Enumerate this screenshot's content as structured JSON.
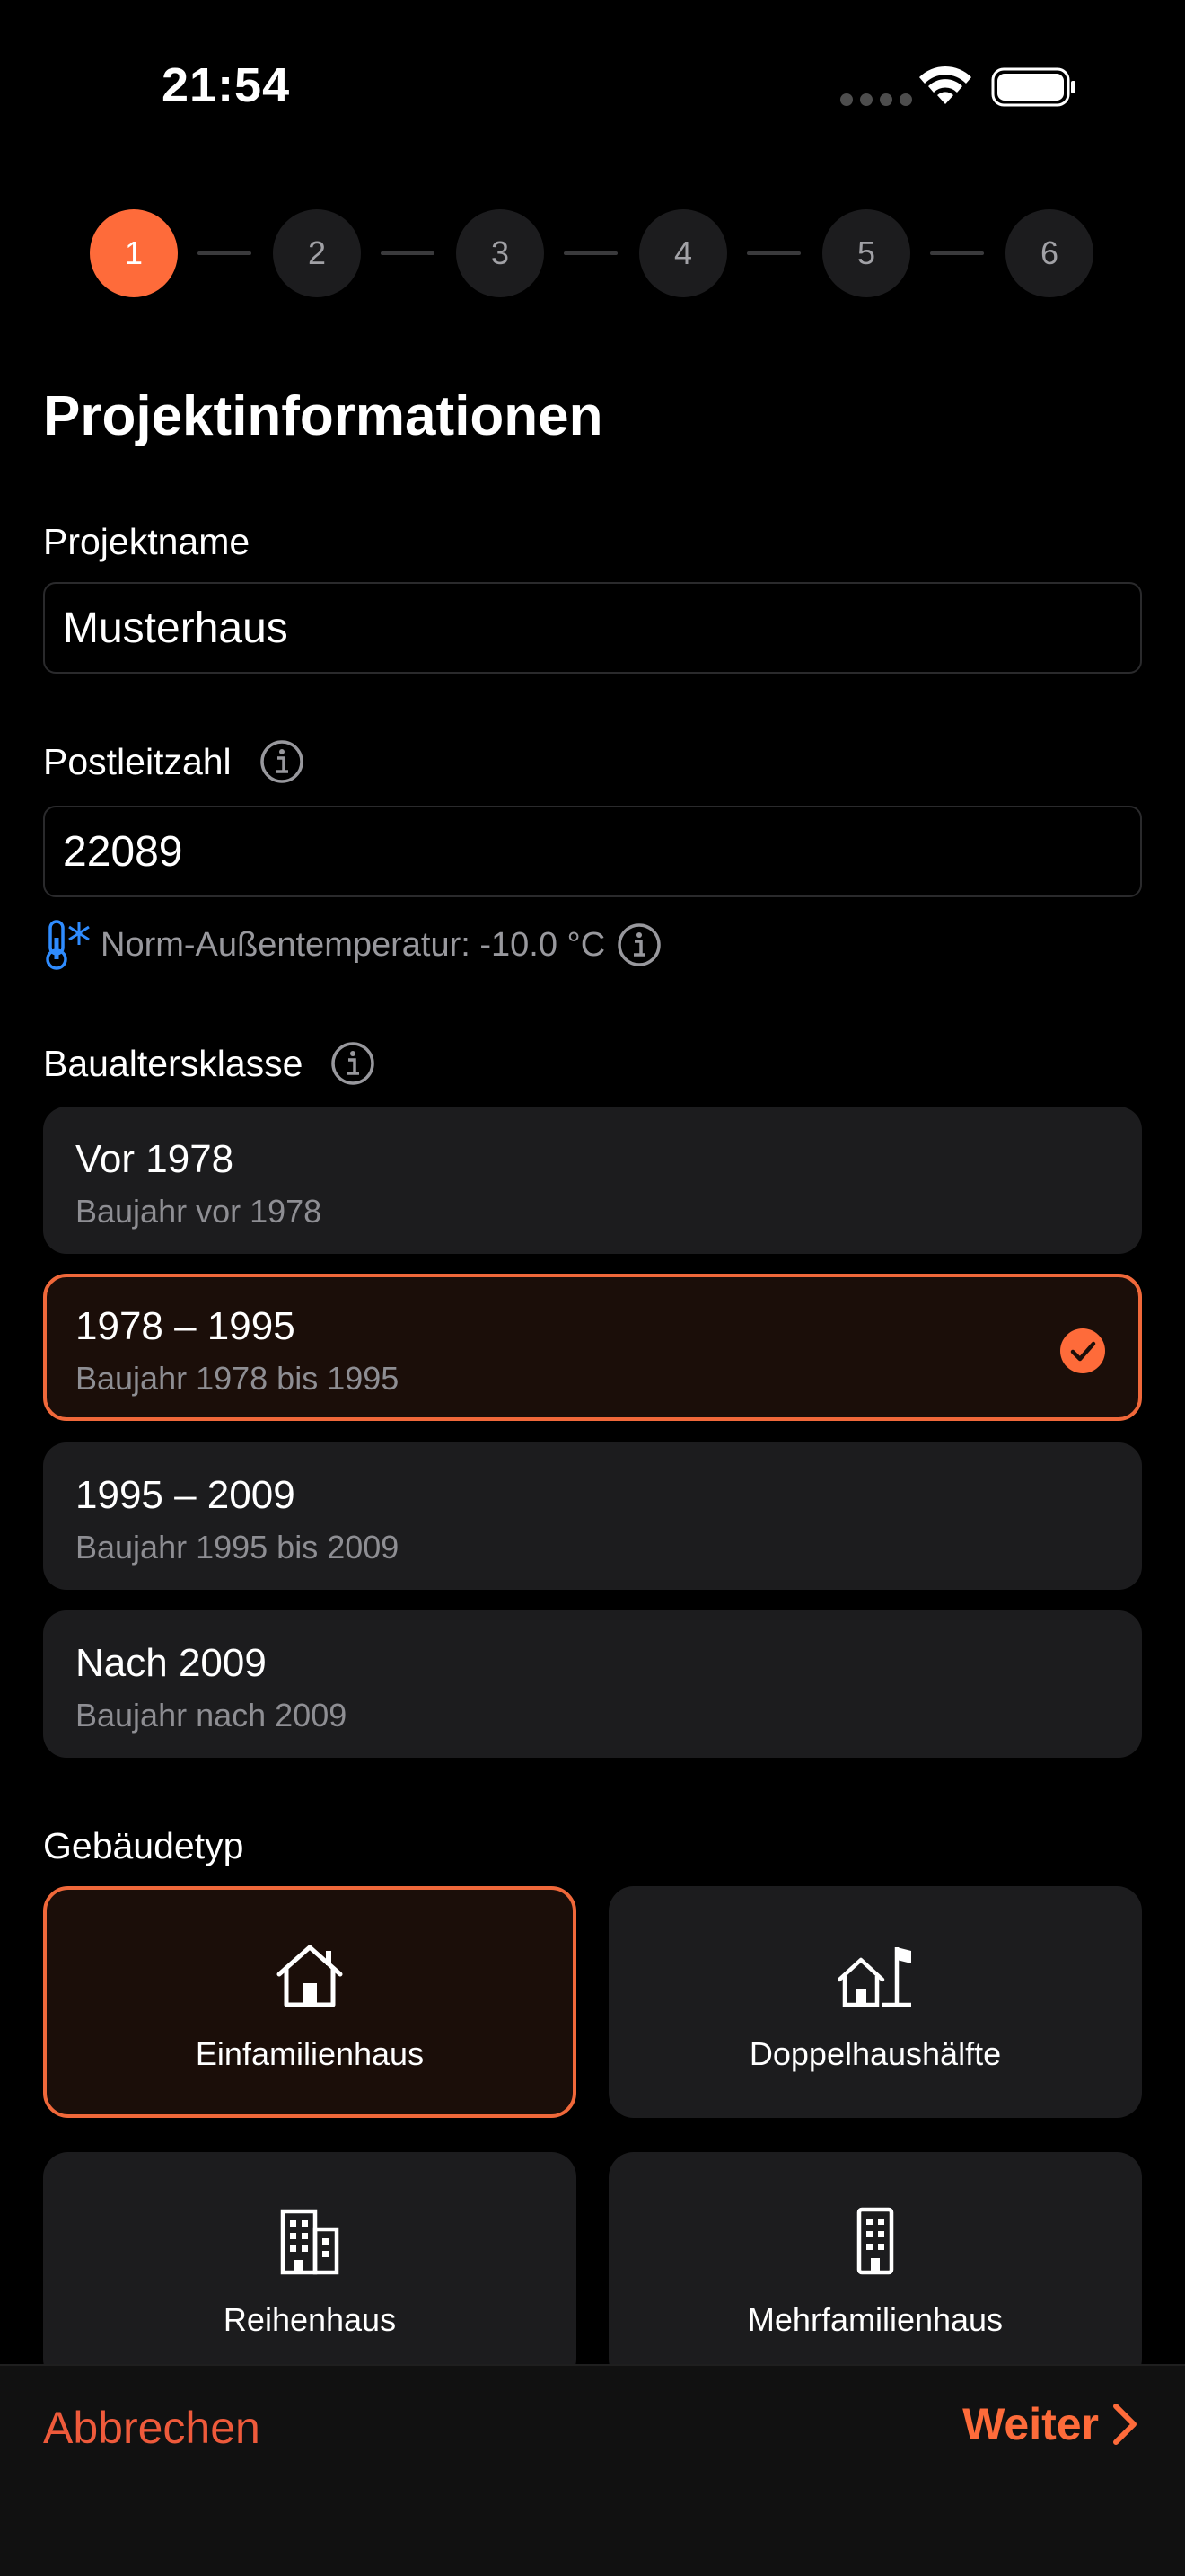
{
  "status_bar": {
    "time": "21:54"
  },
  "stepper": {
    "steps": [
      "1",
      "2",
      "3",
      "4",
      "5",
      "6"
    ],
    "active_index": 0
  },
  "page": {
    "title": "Projektinformationen"
  },
  "project_name": {
    "label": "Projektname",
    "value": "Musterhaus"
  },
  "postal_code": {
    "label": "Postleitzahl",
    "value": "22089",
    "hint": "Norm-Außentemperatur: -10.0 °C"
  },
  "construction_class": {
    "label": "Baualtersklasse",
    "options": [
      {
        "title": "Vor 1978",
        "subtitle": "Baujahr vor 1978",
        "selected": false
      },
      {
        "title": "1978 – 1995",
        "subtitle": "Baujahr 1978 bis 1995",
        "selected": true
      },
      {
        "title": "1995 – 2009",
        "subtitle": "Baujahr 1995 bis 2009",
        "selected": false
      },
      {
        "title": "Nach 2009",
        "subtitle": "Baujahr nach 2009",
        "selected": false
      }
    ]
  },
  "building_type": {
    "label": "Gebäudetyp",
    "options": [
      {
        "label": "Einfamilienhaus",
        "icon": "house-icon",
        "selected": true
      },
      {
        "label": "Doppelhaushälfte",
        "icon": "semi-detached-house-icon",
        "selected": false
      },
      {
        "label": "Reihenhaus",
        "icon": "row-house-building-icon",
        "selected": false
      },
      {
        "label": "Mehrfamilienhaus",
        "icon": "apartment-building-icon",
        "selected": false
      }
    ]
  },
  "footer": {
    "cancel_label": "Abbrechen",
    "next_label": "Weiter"
  },
  "colors": {
    "accent": "#fe6b3a",
    "cancel": "#ee5a3b",
    "card": "#1c1c1e",
    "info_blue": "#2f8cff"
  }
}
